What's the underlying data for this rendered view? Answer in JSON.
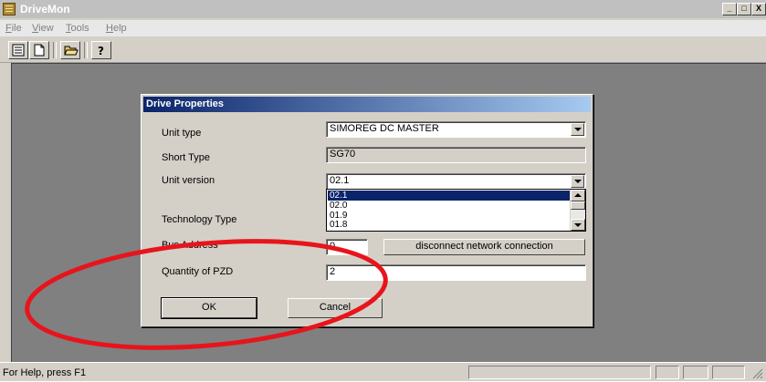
{
  "app": {
    "title": "DriveMon",
    "window_buttons": [
      "_",
      "□",
      "X"
    ]
  },
  "menu": [
    {
      "label": "File",
      "mnemonic": "F",
      "rest": "ile"
    },
    {
      "label": "View",
      "mnemonic": "V",
      "rest": "iew"
    },
    {
      "label": "Tools",
      "mnemonic": "T",
      "rest": "ools"
    },
    {
      "label": "Help",
      "mnemonic": "H",
      "rest": "elp"
    }
  ],
  "toolbar": {
    "icons": [
      "list-icon",
      "new-document-icon",
      "open-folder-icon",
      "help-icon"
    ]
  },
  "dialog": {
    "title": "Drive Properties",
    "unit_type": {
      "label": "Unit type",
      "value": "SIMOREG DC MASTER"
    },
    "short_type": {
      "label": "Short Type",
      "value": "SG70"
    },
    "unit_version": {
      "label": "Unit version",
      "value": "02.1",
      "options": [
        "02.1",
        "02.0",
        "01.9",
        "01.8"
      ],
      "selected": "02.1"
    },
    "technology_type": {
      "label": "Technology Type",
      "mnemonic": "y"
    },
    "bus_address": {
      "label": "Bus Address",
      "value": "0"
    },
    "disconnect_button": "disconnect network connection",
    "pzd": {
      "label": "Quantity of PZD",
      "value": "2"
    },
    "ok": "OK",
    "cancel": "Cancel"
  },
  "status": {
    "text": "For Help, press F1"
  },
  "annotation": {
    "ellipse_color": "#e8141c"
  }
}
